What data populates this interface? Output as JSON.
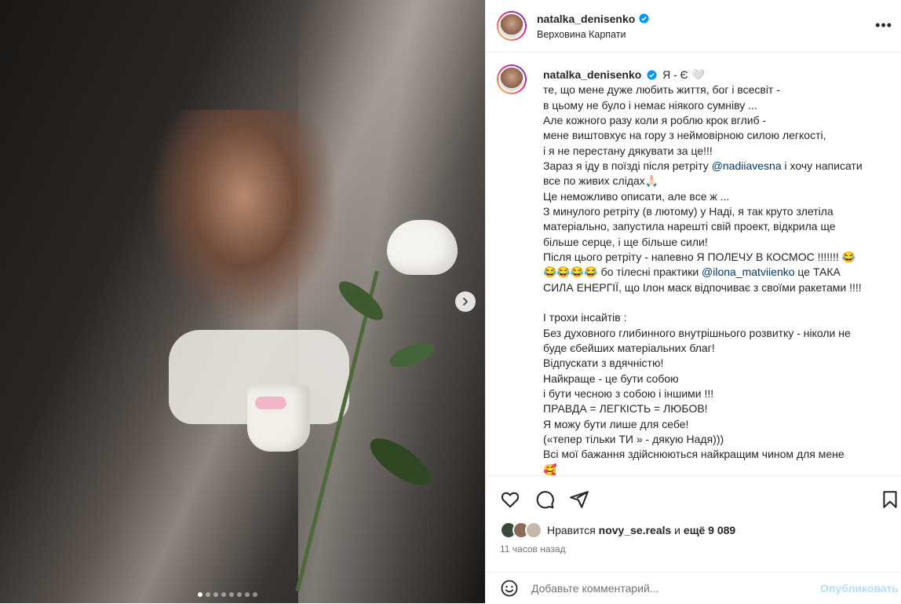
{
  "post": {
    "username": "natalka_denisenko",
    "location": "Верховина Карпати",
    "more_label": "•••",
    "carousel": {
      "total": 8,
      "active": 1
    }
  },
  "caption": {
    "username": "natalka_denisenko",
    "lines": [
      "Я - Є 🤍",
      "те, що мене дуже любить життя, бог і всесвіт -",
      "в цьому не було і немає ніякого сумніву ...",
      "Але кожного разу коли я роблю крок вглиб -",
      "мене виштовхує на гору з неймовірною силою легкості,",
      "і я не перестану дякувати за це!!!",
      "Зараз я іду в поїзді після ретріту ",
      "@nadiiavesna",
      " і хочу написати",
      "все по живих слідах🙏🏻",
      "Це неможливо описати, але все ж ...",
      "З минулого ретріту (в лютому) у Наді, я так круто злетіла",
      "матеріально, запустила нарешті свій проект, відкрила ще",
      "більше серце, і ще більше сили!",
      "Після цього ретріту - напевно Я ПОЛЕЧУ В КОСМОС !!!!!!! 😂",
      "😂😂😂😂",
      " бо тілесні практики ",
      "@ilona_matviienko",
      " це ТАКА",
      "СИЛА ЕНЕРГІЇ, що Ілон маск відпочиває з своїми ракетами !!!!",
      "",
      "І трохи інсайтів :",
      "Без духовного глибинного внутрішнього розвитку - ніколи не",
      "буде єбейших матеріальних благ!",
      "Відпускати з вдячністю!",
      "Найкраще - це бути собою",
      "і бути чесною з собою і іншими !!!",
      "ПРАВДА = ЛЕГКІСТЬ = ЛЮБОВ!",
      "Я можу бути лише для себе!",
      "(«тепер тільки ТИ » - дякую Надя)))",
      "Всі мої бажання здійснюються найкращим чином для мене",
      "🥰"
    ]
  },
  "likes": {
    "prefix": "Нравится ",
    "user": "novy_se.reals",
    "middle": " и ",
    "count": "ещё 9 089"
  },
  "time": "11 часов назад",
  "comment": {
    "placeholder": "Добавьте комментарий...",
    "publish": "Опубликовать"
  },
  "colors": {
    "link": "#00376b",
    "publish_disabled": "#b2dffc",
    "verified": "#0095f6"
  },
  "icons": [
    "heart-icon",
    "comment-icon",
    "share-icon",
    "bookmark-icon",
    "emoji-icon",
    "verified-icon",
    "chevron-right-icon"
  ]
}
